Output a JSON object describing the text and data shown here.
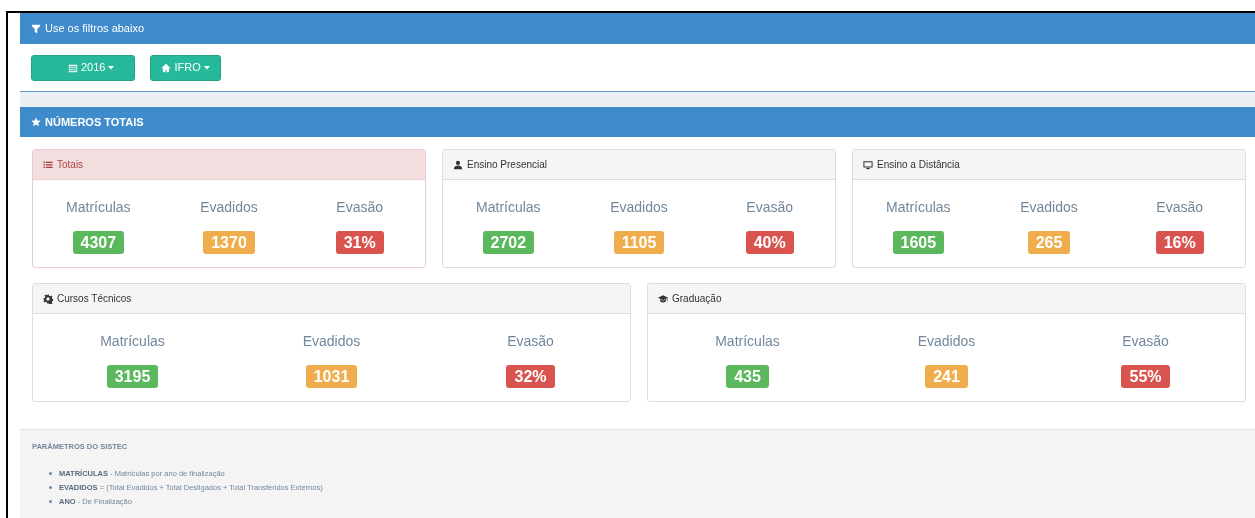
{
  "filter_bar": {
    "title": "Use os filtros abaixo"
  },
  "filters": [
    {
      "kind": "year",
      "label": "2016"
    },
    {
      "kind": "campus",
      "label": "IFRO"
    }
  ],
  "section": {
    "title": "NÚMEROS TOTAIS"
  },
  "panels": [
    {
      "kind": "danger",
      "title": "Totais",
      "stats": [
        {
          "label": "Matrículas",
          "value": "4307",
          "color": "#5cb85c"
        },
        {
          "label": "Evadidos",
          "value": "1370",
          "color": "#f0ad4e"
        },
        {
          "label": "Evasão",
          "value": "31%",
          "color": "#d9534f"
        }
      ]
    },
    {
      "kind": "default",
      "title": "Ensino Presencial",
      "stats": [
        {
          "label": "Matrículas",
          "value": "2702",
          "color": "#5cb85c"
        },
        {
          "label": "Evadidos",
          "value": "1105",
          "color": "#f0ad4e"
        },
        {
          "label": "Evasão",
          "value": "40%",
          "color": "#d9534f"
        }
      ]
    },
    {
      "kind": "default",
      "title": "Ensino a Distância",
      "stats": [
        {
          "label": "Matrículas",
          "value": "1605",
          "color": "#5cb85c"
        },
        {
          "label": "Evadidos",
          "value": "265",
          "color": "#f0ad4e"
        },
        {
          "label": "Evasão",
          "value": "16%",
          "color": "#d9534f"
        }
      ]
    },
    {
      "kind": "default",
      "title": "Cursos Técnicos",
      "stats": [
        {
          "label": "Matrículas",
          "value": "3195",
          "color": "#5cb85c"
        },
        {
          "label": "Evadidos",
          "value": "1031",
          "color": "#f0ad4e"
        },
        {
          "label": "Evasão",
          "value": "32%",
          "color": "#d9534f"
        }
      ]
    },
    {
      "kind": "default",
      "title": "Graduação",
      "stats": [
        {
          "label": "Matrículas",
          "value": "435",
          "color": "#5cb85c"
        },
        {
          "label": "Evadidos",
          "value": "241",
          "color": "#f0ad4e"
        },
        {
          "label": "Evasão",
          "value": "55%",
          "color": "#d9534f"
        }
      ]
    }
  ],
  "parameters": {
    "title": "PARÂMETROS DO SISTEC",
    "items": [
      "**MATRÍCULAS** - Matrículas por ano de finalização",
      "**EVADIDOS** = (Total Evadidos + Total Desligados + Total Transferidos Externos)",
      "**ANO** - De Finalização"
    ]
  }
}
